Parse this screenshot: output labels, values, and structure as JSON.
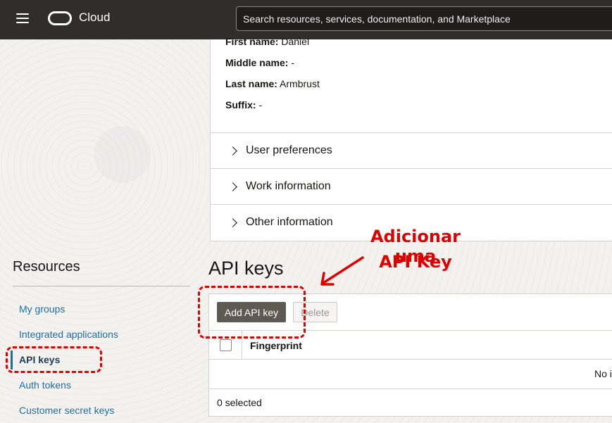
{
  "header": {
    "app_name": "Cloud",
    "search_placeholder": "Search resources, services, documentation, and Marketplace"
  },
  "profile": {
    "fields": [
      {
        "label": "First name:",
        "value": "Daniel"
      },
      {
        "label": "Middle name:",
        "value": "-"
      },
      {
        "label": "Last name:",
        "value": "Armbrust"
      },
      {
        "label": "Suffix:",
        "value": "-"
      }
    ],
    "sections": [
      "User preferences",
      "Work information",
      "Other information"
    ]
  },
  "sidebar": {
    "title": "Resources",
    "items": [
      {
        "label": "My groups",
        "active": false
      },
      {
        "label": "Integrated applications",
        "active": false
      },
      {
        "label": "API keys",
        "active": true
      },
      {
        "label": "Auth tokens",
        "active": false
      },
      {
        "label": "Customer secret keys",
        "active": false
      }
    ]
  },
  "api_keys": {
    "title": "API keys",
    "add_button": "Add API key",
    "delete_button": "Delete",
    "column_fingerprint": "Fingerprint",
    "empty_text": "No items",
    "selected_text": "0 selected"
  },
  "annotation": {
    "line1": "Adicionar uma",
    "line2": "API Key",
    "color": "#e00000"
  }
}
